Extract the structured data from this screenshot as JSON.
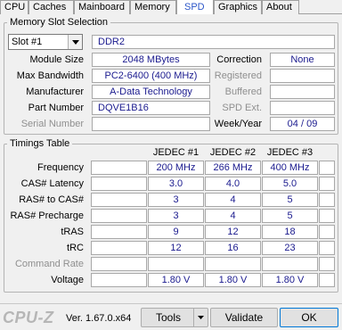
{
  "tabs": [
    "CPU",
    "Caches",
    "Mainboard",
    "Memory",
    "SPD",
    "Graphics",
    "About"
  ],
  "active_tab": "SPD",
  "memory_slot_selection": {
    "title": "Memory Slot Selection",
    "slot": "Slot #1",
    "type": "DDR2",
    "module_size_label": "Module Size",
    "module_size": "2048 MBytes",
    "max_bandwidth_label": "Max Bandwidth",
    "max_bandwidth": "PC2-6400 (400 MHz)",
    "manufacturer_label": "Manufacturer",
    "manufacturer": "A-Data Technology",
    "part_number_label": "Part Number",
    "part_number": "DQVE1B16",
    "serial_number_label": "Serial Number",
    "serial_number": "",
    "correction_label": "Correction",
    "correction": "None",
    "registered_label": "Registered",
    "registered": "",
    "buffered_label": "Buffered",
    "buffered": "",
    "spd_ext_label": "SPD Ext.",
    "spd_ext": "",
    "week_year_label": "Week/Year",
    "week_year": "04 / 09"
  },
  "timings": {
    "title": "Timings Table",
    "columns": [
      "JEDEC #1",
      "JEDEC #2",
      "JEDEC #3"
    ],
    "rows": [
      {
        "label": "Frequency",
        "values": [
          "200 MHz",
          "266 MHz",
          "400 MHz"
        ]
      },
      {
        "label": "CAS# Latency",
        "values": [
          "3.0",
          "4.0",
          "5.0"
        ]
      },
      {
        "label": "RAS# to CAS#",
        "values": [
          "3",
          "4",
          "5"
        ]
      },
      {
        "label": "RAS# Precharge",
        "values": [
          "3",
          "4",
          "5"
        ]
      },
      {
        "label": "tRAS",
        "values": [
          "9",
          "12",
          "18"
        ]
      },
      {
        "label": "tRC",
        "values": [
          "12",
          "16",
          "23"
        ]
      },
      {
        "label": "Command Rate",
        "values": [
          "",
          "",
          ""
        ]
      },
      {
        "label": "Voltage",
        "values": [
          "1.80 V",
          "1.80 V",
          "1.80 V"
        ]
      }
    ]
  },
  "footer": {
    "logo": "CPU-Z",
    "version": "Ver. 1.67.0.x64",
    "tools_label": "Tools",
    "validate_label": "Validate",
    "ok_label": "OK"
  },
  "colors": {
    "value_text": "#1a1a8e",
    "active_tab_text": "#2c56c8",
    "disabled_label": "#8f8f8f"
  }
}
